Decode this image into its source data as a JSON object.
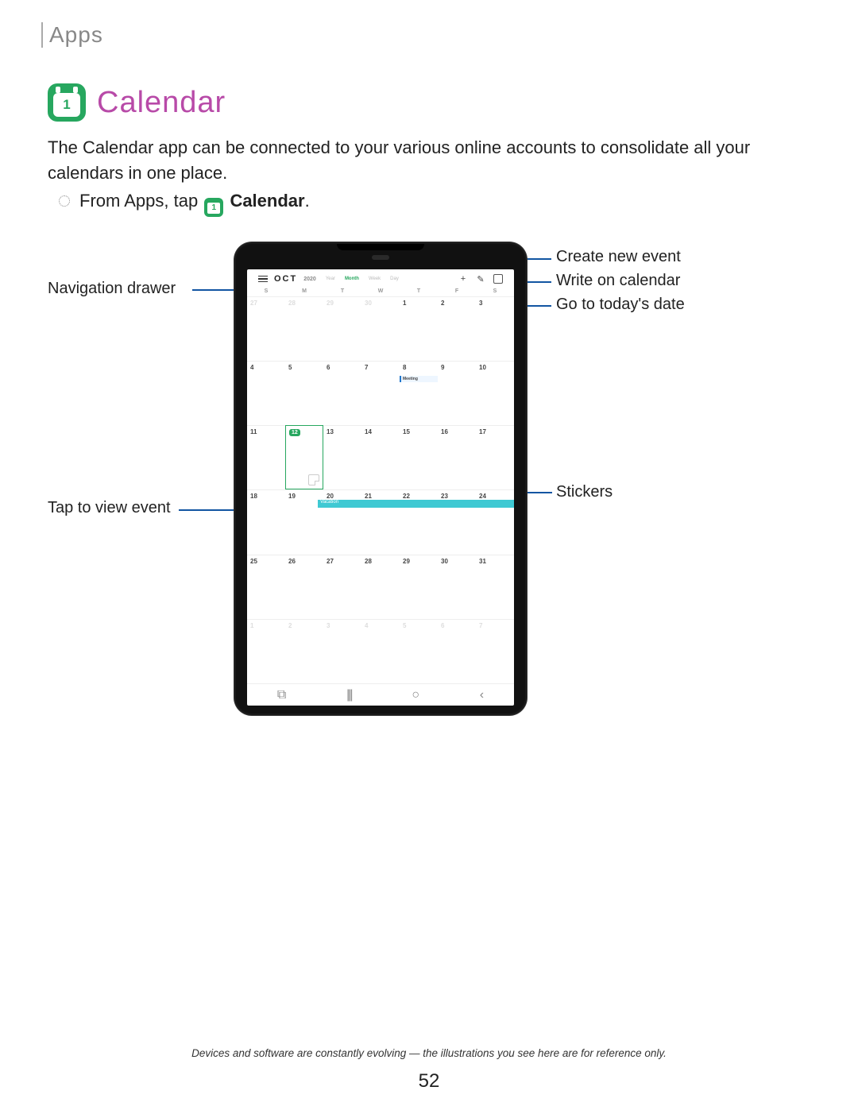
{
  "header": {
    "breadcrumb": "Apps"
  },
  "section": {
    "icon_num": "1",
    "title": "Calendar",
    "intro": "The Calendar app can be connected to your various online accounts to consolidate all your calendars in one place.",
    "step_prefix": "From Apps, tap",
    "step_icon_num": "1",
    "step_app": "Calendar"
  },
  "callouts": {
    "nav_drawer": "Navigation drawer",
    "tap_event": "Tap to view event",
    "create_event": "Create new event",
    "write_calendar": "Write on calendar",
    "goto_today": "Go to today's date",
    "stickers": "Stickers"
  },
  "device": {
    "toolbar": {
      "month": "OCT",
      "year": "2020",
      "views": [
        "Year",
        "Month",
        "Week",
        "Day"
      ],
      "active_view": 1,
      "icons": {
        "add": "+",
        "pen": "✎",
        "today": "⌂"
      }
    },
    "dow": [
      "S",
      "M",
      "T",
      "W",
      "T",
      "F",
      "S"
    ],
    "weeks": [
      [
        {
          "n": "27",
          "f": true
        },
        {
          "n": "28",
          "f": true
        },
        {
          "n": "29",
          "f": true
        },
        {
          "n": "30",
          "f": true
        },
        {
          "n": "1"
        },
        {
          "n": "2"
        },
        {
          "n": "3"
        }
      ],
      [
        {
          "n": "4"
        },
        {
          "n": "5"
        },
        {
          "n": "6"
        },
        {
          "n": "7"
        },
        {
          "n": "8",
          "ev": "Meeting"
        },
        {
          "n": "9"
        },
        {
          "n": "10"
        }
      ],
      [
        {
          "n": "11"
        },
        {
          "n": "12",
          "today": true,
          "sticker": true
        },
        {
          "n": "13"
        },
        {
          "n": "14"
        },
        {
          "n": "15"
        },
        {
          "n": "16"
        },
        {
          "n": "17"
        }
      ],
      [
        {
          "n": "18"
        },
        {
          "n": "19"
        },
        {
          "n": "20"
        },
        {
          "n": "21"
        },
        {
          "n": "22"
        },
        {
          "n": "23"
        },
        {
          "n": "24"
        }
      ],
      [
        {
          "n": "25"
        },
        {
          "n": "26"
        },
        {
          "n": "27"
        },
        {
          "n": "28"
        },
        {
          "n": "29"
        },
        {
          "n": "30"
        },
        {
          "n": "31"
        }
      ],
      [
        {
          "n": "1",
          "f": true
        },
        {
          "n": "2",
          "f": true
        },
        {
          "n": "3",
          "f": true
        },
        {
          "n": "4",
          "f": true
        },
        {
          "n": "5",
          "f": true
        },
        {
          "n": "6",
          "f": true
        },
        {
          "n": "7",
          "f": true
        }
      ]
    ],
    "vacation_row": 3,
    "vacation_label": "Vacation",
    "nav": {
      "recent": "⧉",
      "home": "|||",
      "back": "○",
      "extra": "‹"
    }
  },
  "footer": {
    "disclaimer": "Devices and software are constantly evolving — the illustrations you see here are for reference only.",
    "page": "52"
  }
}
